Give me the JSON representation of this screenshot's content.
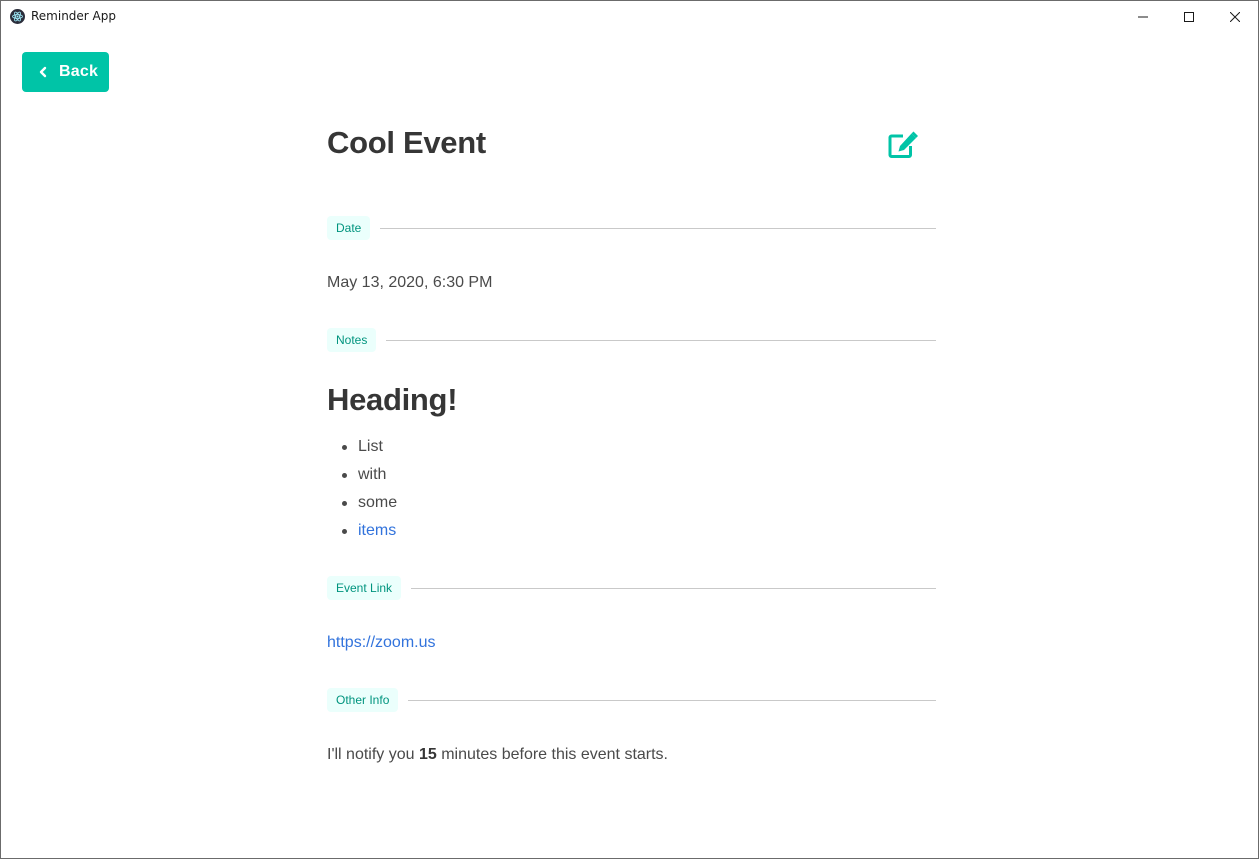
{
  "window": {
    "title": "Reminder App",
    "icon": "electron-atom-icon"
  },
  "back_button": {
    "label": "Back",
    "icon": "chevron-left-icon"
  },
  "event": {
    "title": "Cool Event",
    "edit_icon": "edit-icon"
  },
  "sections": {
    "date": {
      "tag": "Date",
      "value": "May 13, 2020, 6:30 PM"
    },
    "notes": {
      "tag": "Notes",
      "heading": "Heading!",
      "items": [
        "List",
        "with",
        "some",
        "items"
      ]
    },
    "event_link": {
      "tag": "Event Link",
      "url": "https://zoom.us"
    },
    "other_info": {
      "tag": "Other Info",
      "prefix": "I'll notify you ",
      "minutes": "15",
      "suffix": " minutes before this event starts."
    }
  },
  "colors": {
    "accent": "#00c4a7",
    "tag_bg": "#ebfffc",
    "tag_text": "#00947e",
    "link": "#3273dc"
  }
}
